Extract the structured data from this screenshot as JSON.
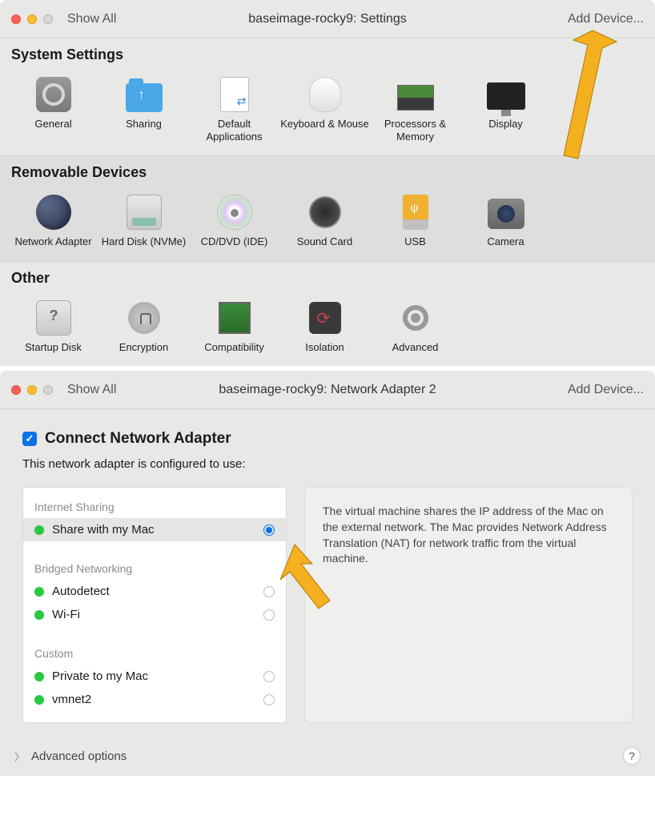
{
  "window1": {
    "showAll": "Show All",
    "title": "baseimage-rocky9: Settings",
    "addDevice": "Add Device...",
    "sections": {
      "system": {
        "header": "System Settings",
        "items": [
          {
            "label": "General",
            "icon": "gear-icon"
          },
          {
            "label": "Sharing",
            "icon": "folder-icon"
          },
          {
            "label": "Default Applications",
            "icon": "doc-icon"
          },
          {
            "label": "Keyboard & Mouse",
            "icon": "mouse-icon"
          },
          {
            "label": "Processors & Memory",
            "icon": "ram-icon"
          },
          {
            "label": "Display",
            "icon": "display-icon"
          }
        ]
      },
      "removable": {
        "header": "Removable Devices",
        "items": [
          {
            "label": "Network Adapter",
            "icon": "globe-icon"
          },
          {
            "label": "Hard Disk (NVMe)",
            "icon": "disk-icon"
          },
          {
            "label": "CD/DVD (IDE)",
            "icon": "cd-icon"
          },
          {
            "label": "Sound Card",
            "icon": "speaker-icon"
          },
          {
            "label": "USB",
            "icon": "usb-icon"
          },
          {
            "label": "Camera",
            "icon": "camera-icon"
          }
        ]
      },
      "other": {
        "header": "Other",
        "items": [
          {
            "label": "Startup Disk",
            "icon": "startup-icon"
          },
          {
            "label": "Encryption",
            "icon": "lock-icon"
          },
          {
            "label": "Compatibility",
            "icon": "chip-icon"
          },
          {
            "label": "Isolation",
            "icon": "iso-icon"
          },
          {
            "label": "Advanced",
            "icon": "adv-icon"
          }
        ]
      }
    }
  },
  "window2": {
    "showAll": "Show All",
    "title": "baseimage-rocky9: Network Adapter 2",
    "addDevice": "Add Device...",
    "connectLabel": "Connect Network Adapter",
    "subdesc": "This network adapter is configured to use:",
    "groups": {
      "internet": {
        "label": "Internet Sharing",
        "items": [
          {
            "label": "Share with my Mac",
            "selected": true
          }
        ]
      },
      "bridged": {
        "label": "Bridged Networking",
        "items": [
          {
            "label": "Autodetect",
            "selected": false
          },
          {
            "label": "Wi-Fi",
            "selected": false
          }
        ]
      },
      "custom": {
        "label": "Custom",
        "items": [
          {
            "label": "Private to my Mac",
            "selected": false
          },
          {
            "label": "vmnet2",
            "selected": false
          }
        ]
      }
    },
    "infoText": "The virtual machine shares the IP address of the Mac on the external network. The Mac provides Network Address Translation (NAT) for network traffic from the virtual machine.",
    "advancedOptions": "Advanced options"
  }
}
